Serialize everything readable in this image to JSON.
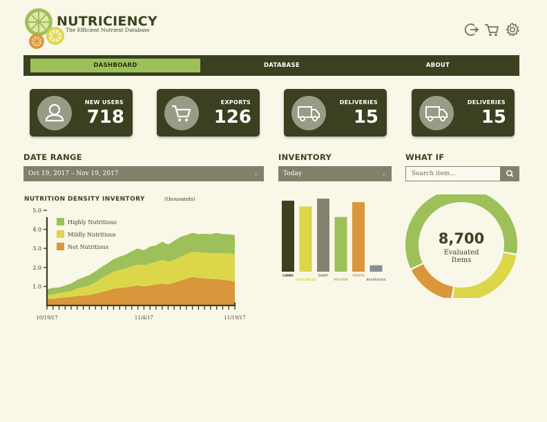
{
  "brand": {
    "name": "NUTRICIENCY",
    "tagline": "The Efficient Nutrient Database"
  },
  "header_icons": [
    "logout-icon",
    "cart-icon",
    "gear-icon"
  ],
  "nav": {
    "tabs": [
      {
        "label": "DASHBOARD",
        "active": true
      },
      {
        "label": "DATABASE",
        "active": false
      },
      {
        "label": "ABOUT",
        "active": false
      }
    ]
  },
  "stats": [
    {
      "label": "NEW USERS",
      "value": "718",
      "icon": "user-icon"
    },
    {
      "label": "EXPORTS",
      "value": "126",
      "icon": "cart-icon"
    },
    {
      "label": "DELIVERIES",
      "value": "15",
      "icon": "truck-icon"
    },
    {
      "label": "DELIVERIES",
      "value": "15",
      "icon": "truck-icon"
    }
  ],
  "date_range": {
    "heading": "DATE RANGE",
    "value": "Oct 19, 2017 – Nov 19, 2017"
  },
  "inventory": {
    "heading": "INVENTORY",
    "value": "Today"
  },
  "what_if": {
    "heading": "WHAT IF",
    "placeholder": "Search item..."
  },
  "colors": {
    "dark": "#3a4020",
    "green": "#9ec05a",
    "yellow": "#dbd64a",
    "orange": "#d9963a",
    "gray": "#838370",
    "slate": "#8a8d96",
    "background": "#f9f7e8"
  },
  "chart_data": [
    {
      "type": "area",
      "title": "NUTRITION  DENSITY  INVENTORY",
      "subtitle": "(thousands)",
      "ylim": [
        0,
        5
      ],
      "yticks": [
        "1.0",
        "2.0",
        "3.0",
        "4.0",
        "5.0"
      ],
      "xlim": [
        0,
        31
      ],
      "xticks": [
        {
          "x": 0,
          "label": "10/19/17"
        },
        {
          "x": 16,
          "label": "11/4/17"
        },
        {
          "x": 31,
          "label": "11/19/17"
        }
      ],
      "legend_position": "top-left",
      "stacked": true,
      "x": [
        0,
        1,
        2,
        3,
        4,
        5,
        6,
        7,
        8,
        9,
        10,
        11,
        12,
        13,
        14,
        15,
        16,
        17,
        18,
        19,
        20,
        21,
        22,
        23,
        24,
        25,
        26,
        27,
        28,
        29,
        30,
        31
      ],
      "series": [
        {
          "name": "Not Nutritious",
          "color": "#d9963a",
          "values": [
            0.35,
            0.35,
            0.4,
            0.42,
            0.45,
            0.5,
            0.52,
            0.55,
            0.62,
            0.7,
            0.78,
            0.88,
            0.92,
            0.95,
            1.0,
            1.05,
            1.0,
            1.05,
            1.1,
            1.15,
            1.1,
            1.2,
            1.3,
            1.4,
            1.5,
            1.45,
            1.42,
            1.4,
            1.38,
            1.35,
            1.32,
            1.25
          ]
        },
        {
          "name": "Mildly Nutritious",
          "color": "#dbd64a",
          "values": [
            0.2,
            0.22,
            0.25,
            0.28,
            0.3,
            0.4,
            0.45,
            0.5,
            0.6,
            0.72,
            0.82,
            0.9,
            0.95,
            1.0,
            1.05,
            1.1,
            1.12,
            1.15,
            1.2,
            1.25,
            1.2,
            1.2,
            1.25,
            1.3,
            1.32,
            1.35,
            1.35,
            1.35,
            1.38,
            1.4,
            1.42,
            1.45
          ]
        },
        {
          "name": "Highly Nutritious",
          "color": "#9ec05a",
          "values": [
            0.3,
            0.35,
            0.3,
            0.35,
            0.4,
            0.45,
            0.5,
            0.55,
            0.58,
            0.6,
            0.62,
            0.65,
            0.7,
            0.72,
            0.8,
            0.85,
            0.78,
            0.9,
            0.85,
            0.95,
            0.9,
            1.0,
            1.05,
            1.0,
            1.0,
            0.95,
            1.0,
            1.0,
            1.05,
            1.0,
            1.0,
            1.0
          ]
        }
      ]
    },
    {
      "type": "bar",
      "categories": [
        "CARBS",
        "VEGETABLES",
        "DAIRY",
        "PROTEIN",
        "FRUITS",
        "BEVERAGES"
      ],
      "values": [
        100,
        92,
        103,
        77,
        98,
        9
      ],
      "colors": [
        "#3a4020",
        "#dbd64a",
        "#838370",
        "#9ec05a",
        "#d9963a",
        "#8a8d96"
      ],
      "ylim": [
        0,
        100
      ],
      "ylim_note_hidden": true
    },
    {
      "type": "pie",
      "center_value": "8,700",
      "center_label": "Evaluated Items",
      "categories": [
        "Green",
        "Yellow",
        "Orange"
      ],
      "values": [
        60,
        25,
        15
      ],
      "colors": [
        "#9ec05a",
        "#dbd64a",
        "#d9963a"
      ]
    }
  ]
}
